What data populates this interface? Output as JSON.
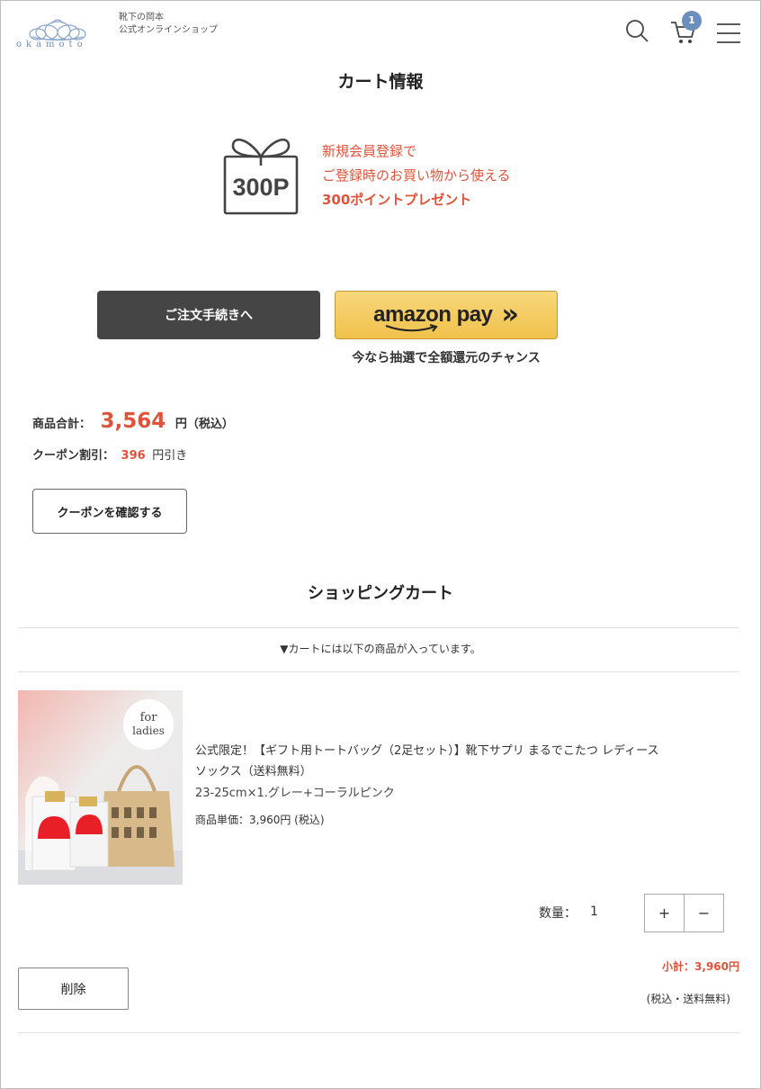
{
  "header": {
    "logo_text": "okamoto",
    "tagline_line1": "靴下の岡本",
    "tagline_line2": "公式オンラインショップ",
    "cart_count": "1",
    "icons": [
      "search-icon",
      "cart-icon",
      "menu-icon"
    ]
  },
  "cart_info": {
    "title": "カート情報",
    "promo_badge": "300P",
    "promo_line1": "新規会員登録で",
    "promo_line2": "ご登録時のお買い物から使える",
    "promo_line3": "300ポイントプレゼント",
    "order_button": "ご注文手続きへ",
    "amazon_label": "amazon pay",
    "amazon_arrows": "»",
    "amazon_note": "今なら抽選で全額還元のチャンス"
  },
  "summary": {
    "total_label": "商品合計：",
    "total_value": "3,564",
    "total_suffix": "円（税込）",
    "coupon_label": "クーポン割引：",
    "coupon_value": "396",
    "coupon_suffix": "円引き",
    "coupon_button": "クーポンを確認する"
  },
  "shopping_cart": {
    "title": "ショッピングカート",
    "note": "▼カートには以下の商品が入っています。",
    "item": {
      "image_badge_line1": "for",
      "image_badge_line2": "ladies",
      "name_line1": "公式限定！【ギフト用トートバッグ（2足セット）】靴下サプリ まるでこたつ レディース",
      "name_line2": "ソックス（送料無料）",
      "variant": "23-25cm×1.グレー+コーラルピンク",
      "unit_price": "商品単価：3,960円 (税込)",
      "qty_label": "数量：",
      "qty_value": "1",
      "plus": "+",
      "minus": "−",
      "subtotal": "小計：3,960円",
      "tax_note": "(税込・送料無料)",
      "delete_button": "削除"
    }
  },
  "colors": {
    "accent_red": "#e0533b",
    "brand_blue": "#6b8fbd",
    "dark_button": "#454545",
    "amazon_yellow": "#f0c14b"
  }
}
